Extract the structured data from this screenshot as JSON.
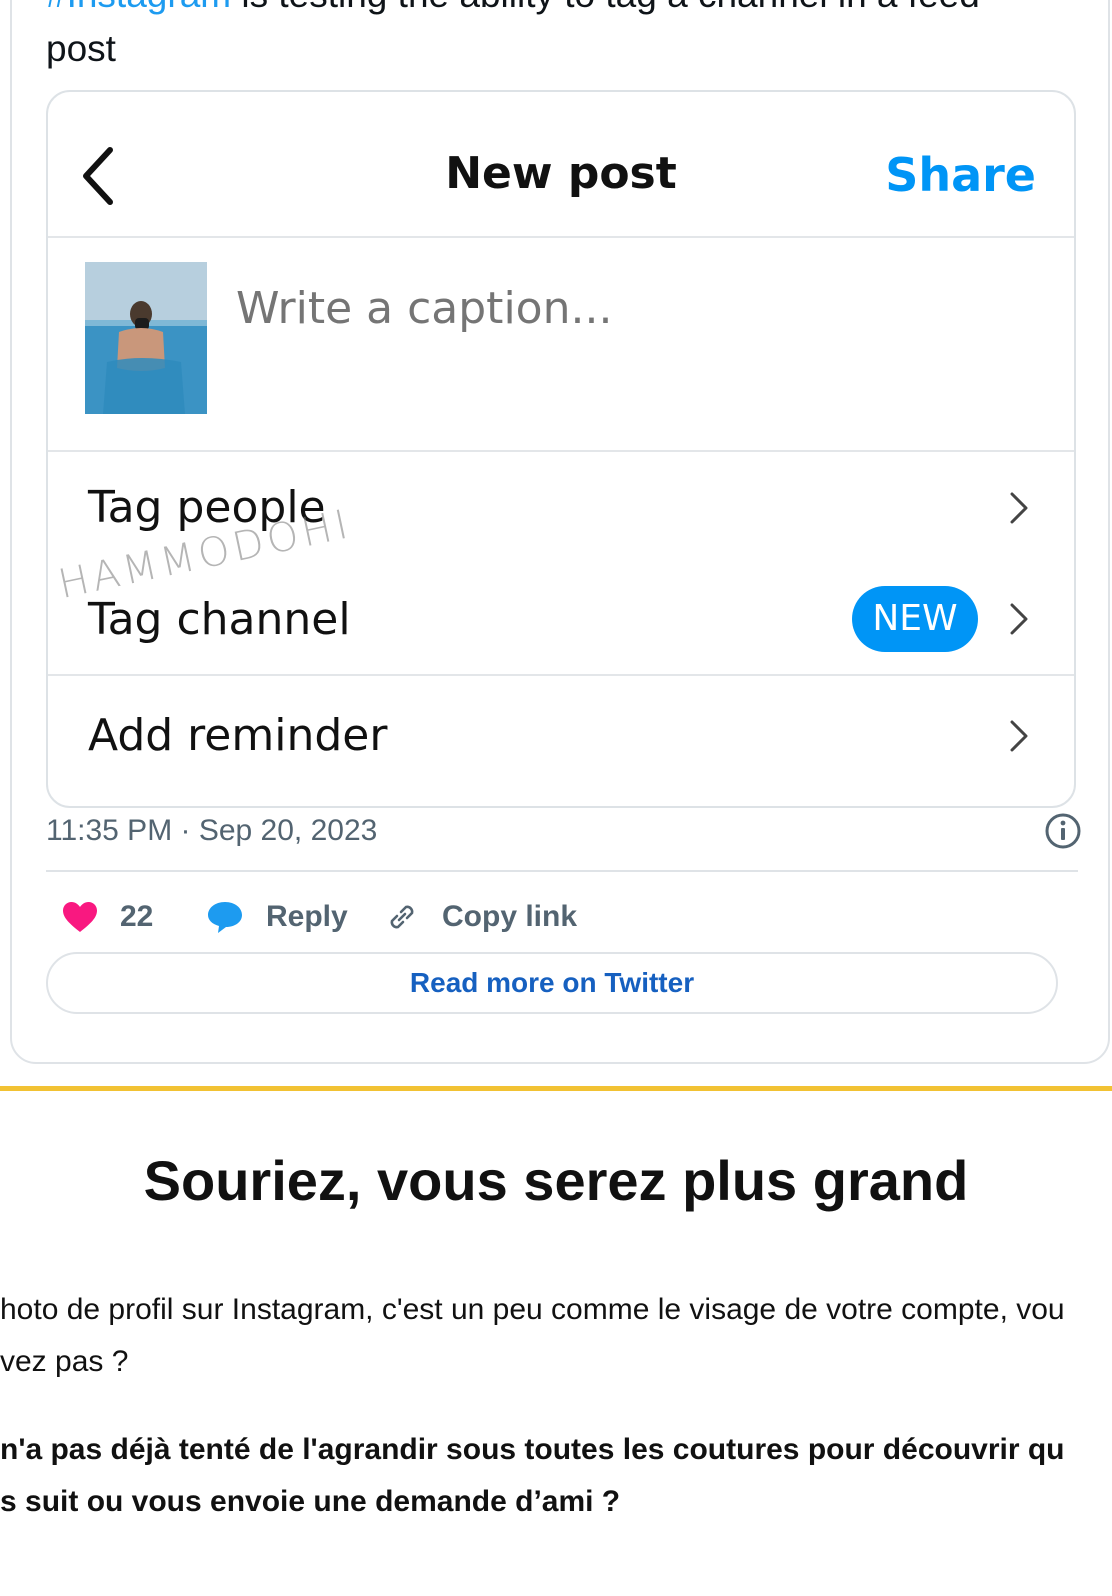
{
  "tweet": {
    "text_hashtag": "#Instagram",
    "text_rest": " is testing the ability to tag a channel in a feed",
    "text_line2": "post",
    "timestamp": "11:35 PM · Sep 20, 2023",
    "likes_count": "22",
    "reply_label": "Reply",
    "copy_link_label": "Copy link",
    "read_more_label": "Read more on Twitter",
    "colors": {
      "like": "#f91880",
      "reply": "#1d9bf0",
      "link": "#1d9bf0"
    }
  },
  "instagram_screen": {
    "title": "New post",
    "share_label": "Share",
    "caption_placeholder": "Write a caption...",
    "menu": [
      {
        "label": "Tag people"
      },
      {
        "label": "Tag channel",
        "badge": "NEW"
      },
      {
        "label": "Add reminder"
      }
    ],
    "watermark": "HAMMODOHI",
    "accent_color": "#0095f6"
  },
  "article": {
    "heading": "Souriez, vous serez plus grand",
    "paragraph1_line1": "hoto de profil sur Instagram, c'est un peu comme le visage de votre compte, vou",
    "paragraph1_line2": "vez pas ?",
    "paragraph2_line1": "n'a pas déjà tenté de l'agrandir sous toutes les coutures pour découvrir qu",
    "paragraph2_line2": "s suit ou vous envoie une demande d’ami ?",
    "rule_color": "#f2c233"
  }
}
